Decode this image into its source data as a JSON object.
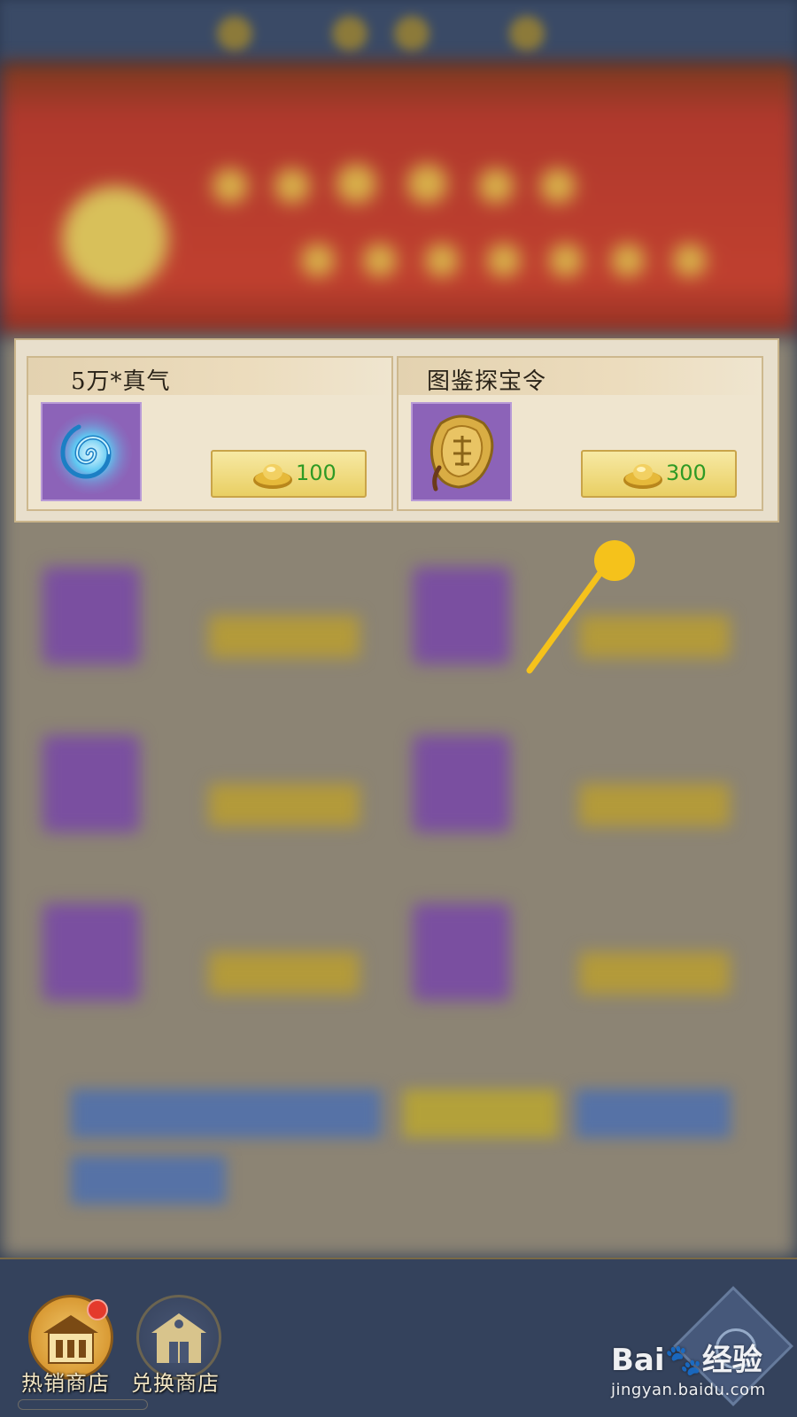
{
  "shop_cards": [
    {
      "title": "5万*真气",
      "icon": "spiral-energy-icon",
      "price": "100",
      "currency_icon": "gold-ingot-icon"
    },
    {
      "title": "图鉴探宝令",
      "icon": "treasure-token-icon",
      "price": "300",
      "currency_icon": "gold-ingot-icon"
    }
  ],
  "bottom_nav": {
    "hot_shop_label": "热销商店",
    "exchange_shop_label": "兑换商店"
  },
  "watermark": {
    "brand_prefix": "Bai",
    "brand_suffix": "经验",
    "url": "jingyan.baidu.com"
  },
  "colors": {
    "price_text": "#2e9a25",
    "accent_gold": "#f5c21b",
    "card_bg": "#efe5cf",
    "bottom_bar": "#34425c"
  }
}
